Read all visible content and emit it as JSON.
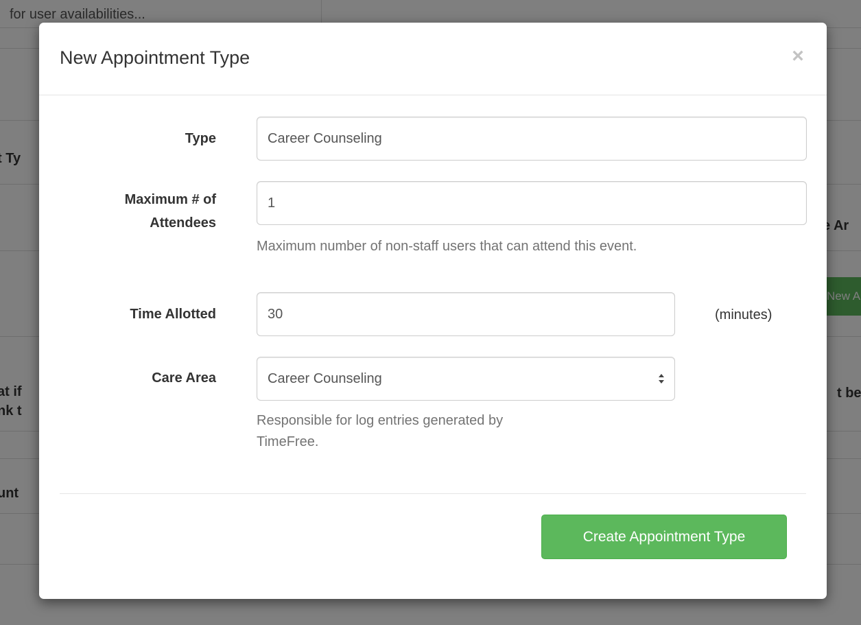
{
  "background": {
    "search_hint": "for user availabilities...",
    "fragment_type": "t Ty",
    "fragment_care": "e Ar",
    "new_button": "New A",
    "fragment_what_if": "at if",
    "fragment_think": "nk t",
    "fragment_but_be": "t be",
    "fragment_count": "unt"
  },
  "modal": {
    "title": "New Appointment Type",
    "close_glyph": "×",
    "fields": {
      "type": {
        "label": "Type",
        "value": "Career Counseling"
      },
      "max_attendees": {
        "label_line1": "Maximum # of",
        "label_line2": "Attendees",
        "value": "1",
        "help": "Maximum number of non-staff users that can attend this event."
      },
      "time_allotted": {
        "label": "Time Allotted",
        "value": "30",
        "unit": "(minutes)"
      },
      "care_area": {
        "label": "Care Area",
        "selected": "Career Counseling",
        "help_line1": "Responsible for log entries generated by",
        "help_line2": "TimeFree."
      }
    },
    "submit_label": "Create Appointment Type"
  },
  "colors": {
    "primary_button": "#5cb85c",
    "help_text": "#737373"
  }
}
